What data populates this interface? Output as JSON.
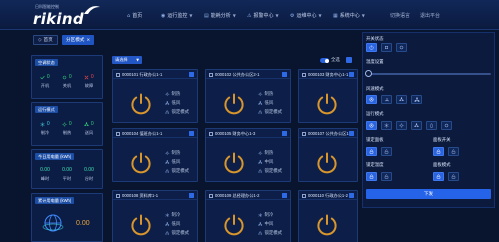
{
  "app": {
    "logo_sub": "日科智能控制",
    "logo": "rikind"
  },
  "nav": {
    "home": "首页",
    "items": [
      "运行监控",
      "能耗分析",
      "报警中心",
      "运维中心",
      "系统中心"
    ],
    "lang": "切换语言",
    "user": "退出平台"
  },
  "tabs": [
    {
      "label": "首页"
    },
    {
      "label": "分区模式"
    }
  ],
  "left": {
    "status": {
      "title": "空调状态",
      "items": [
        {
          "value": "0",
          "label": "开机",
          "icon": "check-icon"
        },
        {
          "value": "0",
          "label": "关机",
          "icon": "ring-icon"
        },
        {
          "value": "0",
          "label": "故障",
          "icon": "cross-icon"
        }
      ]
    },
    "mode": {
      "title": "运行模式",
      "items": [
        {
          "value": "0",
          "label": "制冷",
          "icon": "snow-icon"
        },
        {
          "value": "0",
          "label": "制热",
          "icon": "sun-icon"
        },
        {
          "value": "0",
          "label": "送风",
          "icon": "fan-icon"
        }
      ]
    },
    "today": {
      "title": "今日用电量 (kWh)",
      "items": [
        {
          "value": "0.00",
          "label": "峰时"
        },
        {
          "value": "0.00",
          "label": "平时"
        },
        {
          "value": "0.00",
          "label": "谷时"
        }
      ]
    },
    "total": {
      "title": "累计用电量 (kWh)",
      "value": "0.00"
    }
  },
  "toolbar": {
    "select": "请选择",
    "select_all": "全选"
  },
  "devices": [
    {
      "name": "0000101 行政办公1-1",
      "mode": "制热",
      "fan": "低风",
      "lock": "锁定模式"
    },
    {
      "name": "0000102 公共办公区2-1",
      "mode": "制热",
      "fan": "低风",
      "lock": "锁定模式"
    },
    {
      "name": "0000103 财务中心1-1"
    },
    {
      "name": "0000104 值班办公1-1",
      "mode": "制热",
      "fan": "低风",
      "lock": "锁定模式"
    },
    {
      "name": "0000105 财务中心1-3",
      "mode": "制热",
      "fan": "中风",
      "lock": "锁定模式"
    },
    {
      "name": "0000107 公共办公区1-3"
    },
    {
      "name": "0000108 资料库1-1",
      "mode": "制冷",
      "fan": "低风",
      "lock": "锁定模式"
    },
    {
      "name": "0000109 总经理办公1-2",
      "mode": "制冷",
      "fan": "中风",
      "lock": "锁定模式"
    },
    {
      "name": "0000110 行政办公1-2"
    }
  ],
  "panel": {
    "power_label": "开关状态",
    "temp_label": "温度设置",
    "fan_label": "风速模式",
    "mode_label": "运行模式",
    "lock_panel_label": "锁定面板",
    "panel_switch_label": "面板开关",
    "lock_temp_label": "锁定温度",
    "panel_mode_label": "面板模式",
    "submit": "下发"
  },
  "colors": {
    "background": "#09142e",
    "accent": "#2a63e0",
    "power_icon": "#d8962c",
    "total_value": "#e8a33c",
    "online": "#34d17a",
    "fault": "#f04b4b"
  }
}
